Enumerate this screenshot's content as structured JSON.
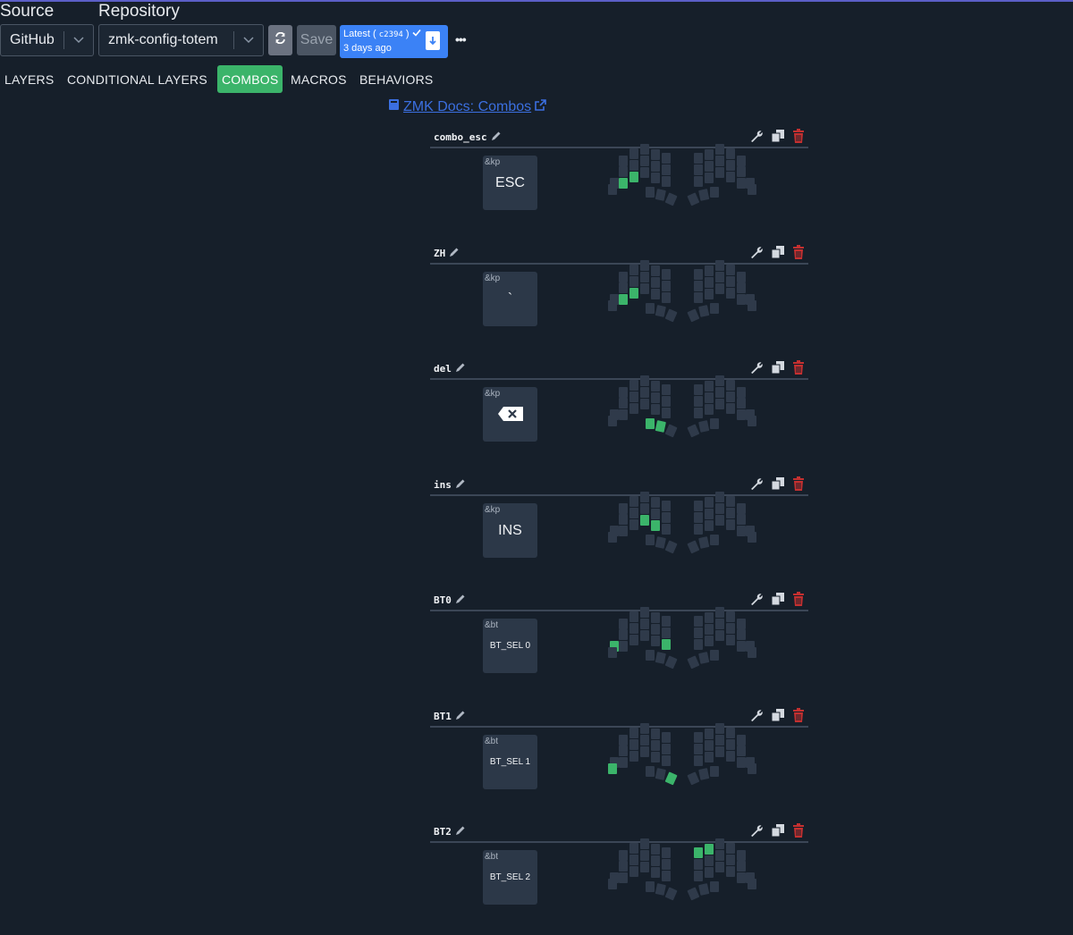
{
  "header": {
    "source_label": "Source",
    "repository_label": "Repository",
    "source_value": "GitHub",
    "repository_value": "zmk-config-totem",
    "save_label": "Save",
    "latest_label": "Latest",
    "latest_sha": "c2394",
    "latest_time": "3 days ago",
    "more_label": "•••"
  },
  "tabs": [
    {
      "label": "LAYERS",
      "active": false
    },
    {
      "label": "CONDITIONAL LAYERS",
      "active": false
    },
    {
      "label": "COMBOS",
      "active": true
    },
    {
      "label": "MACROS",
      "active": false
    },
    {
      "label": "BEHAVIORS",
      "active": false
    }
  ],
  "docs_link": "ZMK Docs: Combos",
  "colors": {
    "accent": "#3bb46a",
    "link": "#3b6fe0",
    "danger": "#c53030",
    "latest": "#3b82f6"
  },
  "combos": [
    {
      "name": "combo_esc",
      "behavior": "&kp",
      "param": "ESC",
      "keys": [
        10,
        11
      ]
    },
    {
      "name": "ZH",
      "behavior": "&kp",
      "param": "`",
      "keys": [
        11,
        10
      ]
    },
    {
      "name": "del",
      "behavior": "&kp",
      "param": "backspace-icon",
      "keys": [
        17,
        18
      ]
    },
    {
      "name": "ins",
      "behavior": "&kp",
      "param": "INS",
      "keys": [
        12,
        13
      ]
    },
    {
      "name": "BT0",
      "behavior": "&bt",
      "param": "BT_SEL 0",
      "keys": [
        14,
        15
      ]
    },
    {
      "name": "BT1",
      "behavior": "&bt",
      "param": "BT_SEL 1",
      "keys": [
        16,
        19
      ]
    },
    {
      "name": "BT2",
      "behavior": "&bt",
      "param": "BT_SEL 2",
      "keys": [
        20,
        21
      ]
    }
  ]
}
